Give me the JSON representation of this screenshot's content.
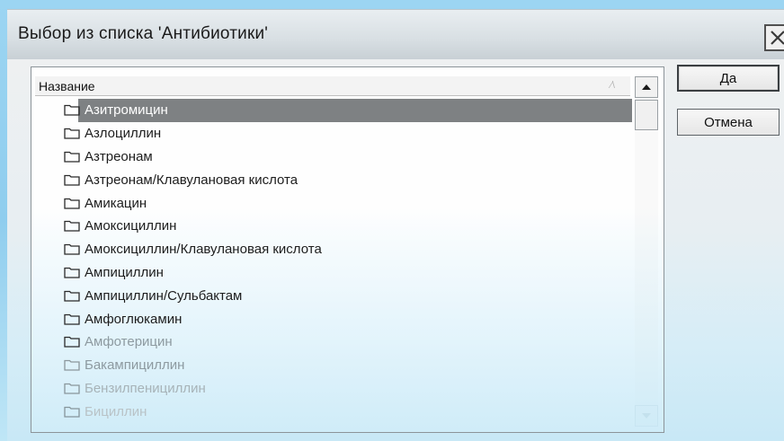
{
  "window": {
    "title": "Выбор из списка 'Антибиотики'"
  },
  "list": {
    "column_header": "Название",
    "items": [
      {
        "label": "Азитромицин",
        "selected": true
      },
      {
        "label": "Азлоциллин"
      },
      {
        "label": "Азтреонам"
      },
      {
        "label": "Азтреонам/Клавулановая кислота"
      },
      {
        "label": "Амикацин"
      },
      {
        "label": "Амоксициллин"
      },
      {
        "label": "Амоксициллин/Клавулановая кислота"
      },
      {
        "label": "Ампициллин"
      },
      {
        "label": "Ампициллин/Сульбактам"
      },
      {
        "label": "Амфоглюкамин"
      },
      {
        "label": "Амфотерицин"
      },
      {
        "label": "Бакампициллин"
      },
      {
        "label": "Бензилпенициллин"
      },
      {
        "label": "Бициллин"
      }
    ]
  },
  "buttons": {
    "ok": "Да",
    "cancel": "Отмена"
  },
  "icons": {
    "close": "close-icon",
    "folder": "folder-icon",
    "scroll_up": "arrow-up-icon",
    "scroll_down": "arrow-down-icon",
    "sort": "sort-indicator-icon"
  },
  "colors": {
    "selection": "#7e8183",
    "frame": "#9cd5f2"
  }
}
